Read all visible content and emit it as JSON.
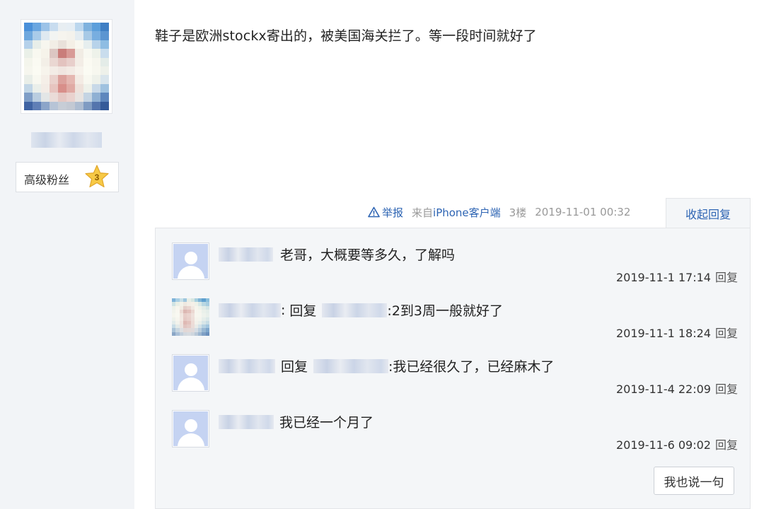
{
  "post": {
    "text": "鞋子是欧洲stockx寄出的，被美国海关拦了。等一段时间就好了",
    "author": {
      "badge_label": "高级粉丝",
      "badge_level": "3",
      "star_color": "#f7c945"
    }
  },
  "meta": {
    "report_label": "举报",
    "client_prefix": "来自",
    "client_name": "iPhone客户端",
    "floor": "3楼",
    "timestamp": "2019-11-01 00:32",
    "collapse_label": "收起回复"
  },
  "replies": [
    {
      "text": "老哥，大概要等多久，了解吗",
      "time": "2019-11-1 17:14",
      "reply_label": "回复"
    },
    {
      "reply_word": "回复",
      "text": ":2到3周一般就好了",
      "time": "2019-11-1 18:24",
      "reply_label": "回复"
    },
    {
      "reply_word": "回复",
      "text": ":我已经很久了，已经麻木了",
      "time": "2019-11-4 22:09",
      "reply_label": "回复"
    },
    {
      "text": "我已经一个月了",
      "time": "2019-11-6 09:02",
      "reply_label": "回复"
    }
  ],
  "say_button_label": "我也说一句",
  "colors": {
    "link": "#2d64b3",
    "panel_bg": "#f4f6f8",
    "sidebar_bg": "#f2f4f7"
  }
}
